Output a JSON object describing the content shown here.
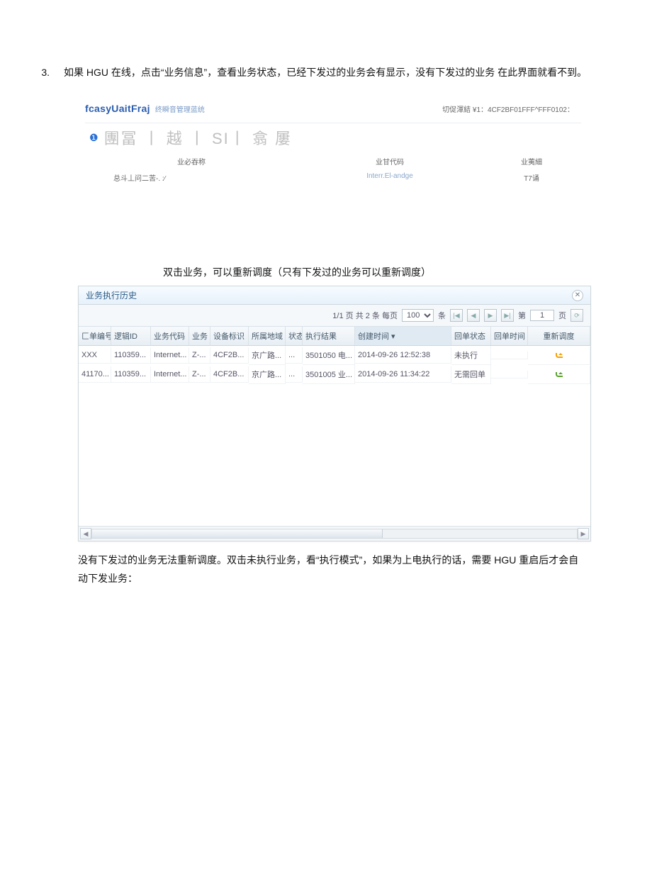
{
  "para1_num": "3.",
  "para1_text": "如果 HGU 在线，点击“业务信息”，查看业务状态，已经下发过的业务会有显示，没有下发过的业务 在此界面就看不到。",
  "emb1": {
    "brand": "fcasyUaitFraj",
    "brand_sub": "终瞬音管理蓝统",
    "switch": "切促渾結 ¥1：4CF2BF01FFF^FFF0102：",
    "tab_bullet": "❶",
    "tab_glyph": "團冨 丨 越 丨 SI丨 翕 屢",
    "h1": "业必吞称",
    "h2": "业甘代码",
    "h3": "业荑細",
    "d1": "总斗丄问二苦-. :∕",
    "d2": "Interr.El-andge",
    "d3": "T7诵"
  },
  "para2": "双击业务，可以重新调度（只有下发过的业务可以重新调度）",
  "panel": {
    "title": "业务执行历史",
    "pager": {
      "pgtext": "1/1 页 共 2 条 每页",
      "perpage": "100",
      "unit": "条",
      "label_page_prefix": "第",
      "page": "1",
      "label_page_suffix": "页"
    },
    "cols": [
      "匚单编号",
      "逻辑ID",
      "业务代码",
      "业务",
      "设备标识",
      "所属地域",
      "状态",
      "执行结果",
      "创建时间 ▾",
      "回单状态",
      "回单时间",
      "重新调度"
    ],
    "rows": [
      {
        "a": "XXX",
        "b": "110359...",
        "c": "Internet...",
        "d": "Z-...",
        "e": "4CF2B...",
        "f": "京广路...",
        "g": "...",
        "h": "3501050 电...",
        "i": "2014-09-26 12:52:38",
        "j": "未执行",
        "k": "",
        "l": "orange"
      },
      {
        "a": "41170...",
        "b": "110359...",
        "c": "Internet...",
        "d": "Z-...",
        "e": "4CF2B...",
        "f": "京广路...",
        "g": "...",
        "h": "3501005 业...",
        "i": "2014-09-26 11:34:22",
        "j": "无需回单",
        "k": "",
        "l": "green"
      }
    ]
  },
  "para3": "没有下发过的业务无法重新调度。双击未执行业务，看“执行模式”，如果为上电执行的话，需要 HGU 重启后才会自动下发业务："
}
